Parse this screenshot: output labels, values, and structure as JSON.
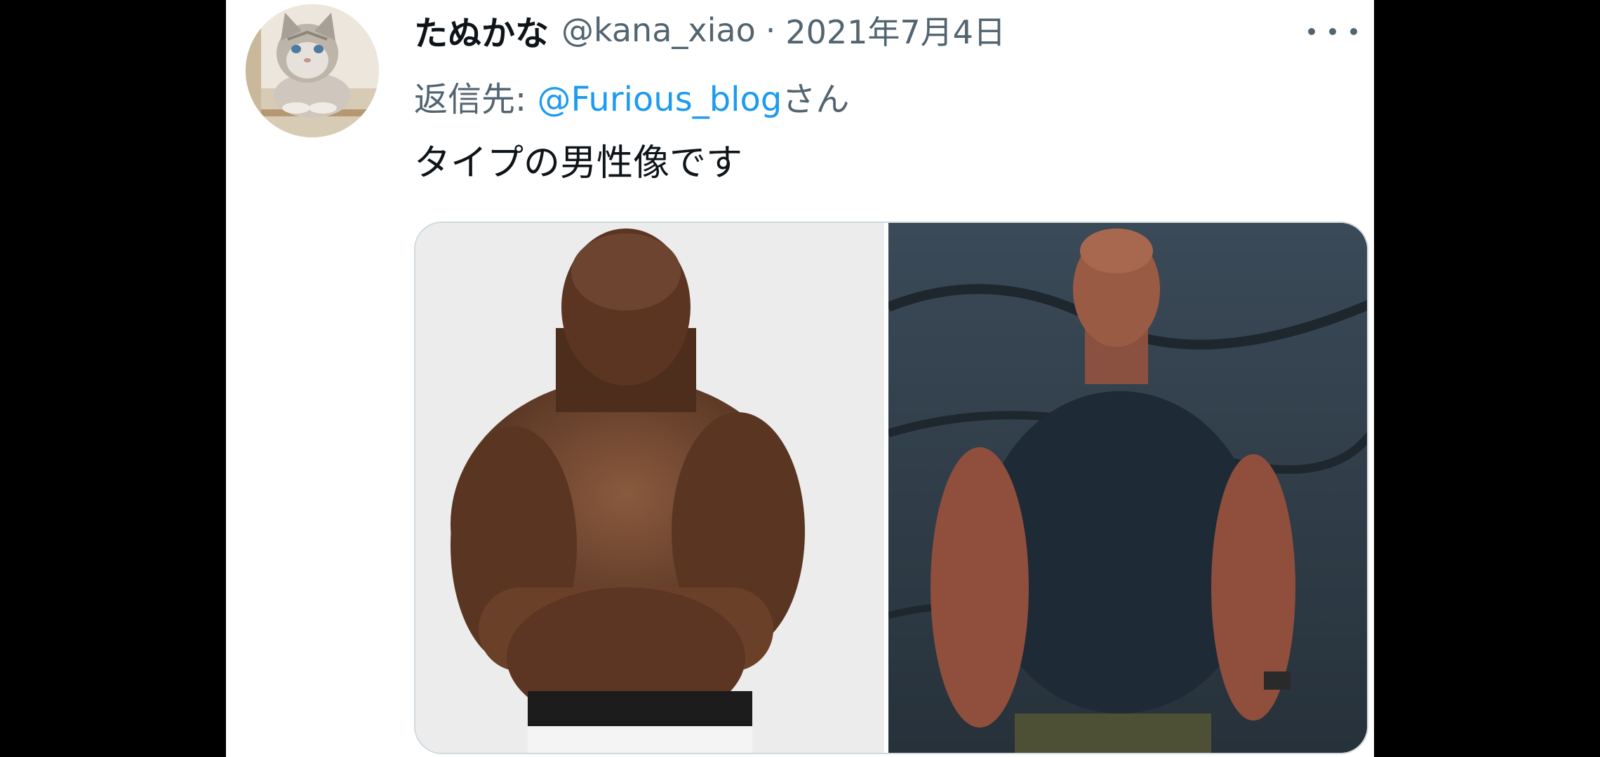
{
  "tweet": {
    "display_name": "たぬかな",
    "handle": "@kana_xiao",
    "separator": "·",
    "date": "2021年7月4日",
    "reply_prefix": "返信先: ",
    "reply_mention": "@Furious_blog",
    "reply_suffix": "さん",
    "text": "タイプの男性像です"
  },
  "colors": {
    "background": "#000000",
    "card": "#ffffff",
    "text_primary": "#0f1419",
    "text_secondary": "#536471",
    "link": "#1d9bf0",
    "border": "#cfd9de"
  },
  "icons": {
    "more": "more-horizontal-icon",
    "avatar": "cat-avatar"
  }
}
